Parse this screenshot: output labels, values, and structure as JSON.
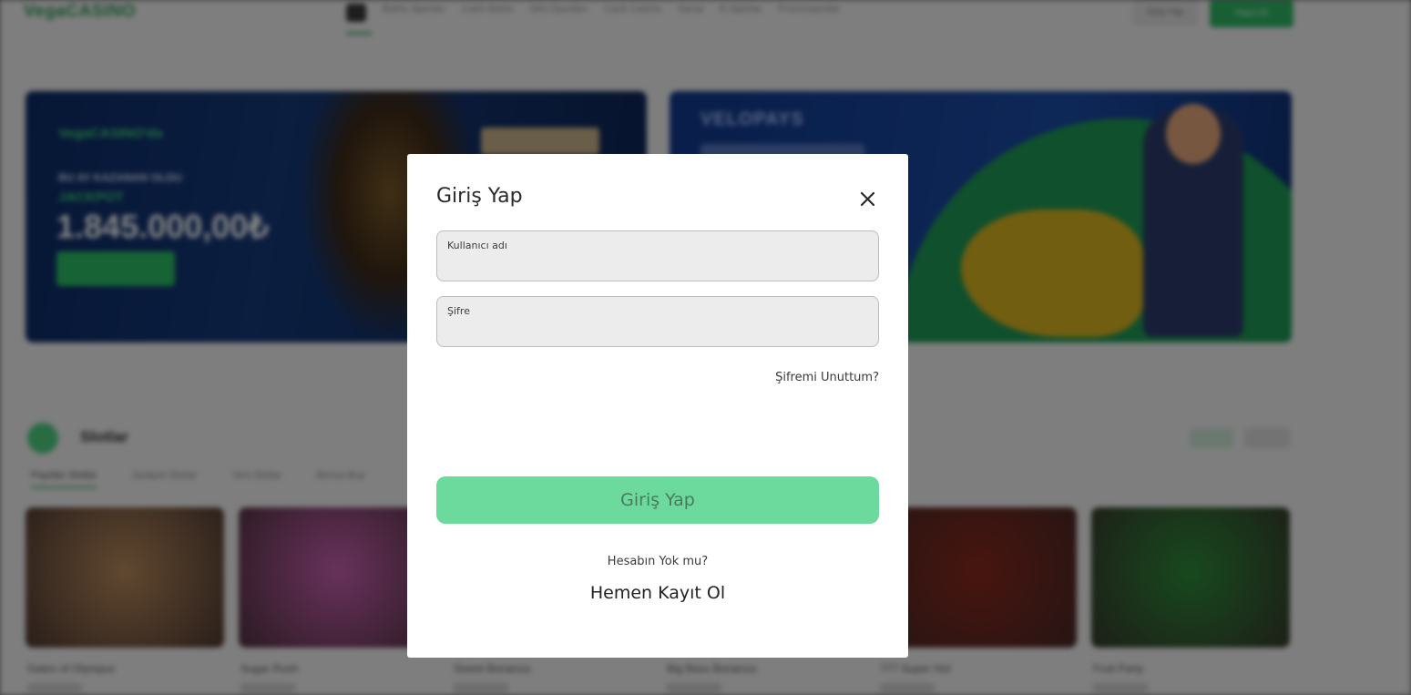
{
  "background": {
    "logo": "VegaCASINO",
    "nav": [
      "Bahis Sporları",
      "Canlı Bahis",
      "Slot Oyunları",
      "Canlı Casino",
      "Sanal",
      "E-Sporlar",
      "Promosyonlar"
    ],
    "login_button": "Giriş Yap",
    "signup_button": "Kayıt Ol",
    "banner_left": {
      "line1": "VegaCASINO'da",
      "line2": "BU AY KAZANAN OLDU",
      "line3": "JACKPOT",
      "amount": "1.845.000,00₺"
    },
    "banner_right": {
      "logo": "VELOPAYS"
    },
    "section": {
      "title": "Slotlar",
      "tabs": [
        "Popüler Slotlar",
        "Jackpot Slotlar",
        "Yeni Slotlar",
        "Bonus Buy"
      ]
    },
    "games": [
      {
        "name": "Gates of Olympus",
        "color": "#b98a5c"
      },
      {
        "name": "Sugar Rush",
        "color": "#c85fb0"
      },
      {
        "name": "Sweet Bonanza",
        "color": "#7ab1d8"
      },
      {
        "name": "Big Bass Bonanza",
        "color": "#4f8fd0"
      },
      {
        "name": "777 Super Hot",
        "color": "#8b2a1c"
      },
      {
        "name": "Fruit Party",
        "color": "#2e8c3a"
      }
    ]
  },
  "colors": {
    "accent": "#6cda9d",
    "overlay": "rgba(0,0,0,0.48)"
  },
  "modal": {
    "title": "Giriş Yap",
    "close_icon": "close-icon",
    "username": {
      "label": "Kullanıcı adı",
      "value": ""
    },
    "password": {
      "label": "Şifre",
      "value": ""
    },
    "forgot_password": "Şifremi Unuttum?",
    "submit_label": "Giriş Yap",
    "no_account_text": "Hesabın Yok mu?",
    "register_link": "Hemen Kayıt Ol"
  }
}
